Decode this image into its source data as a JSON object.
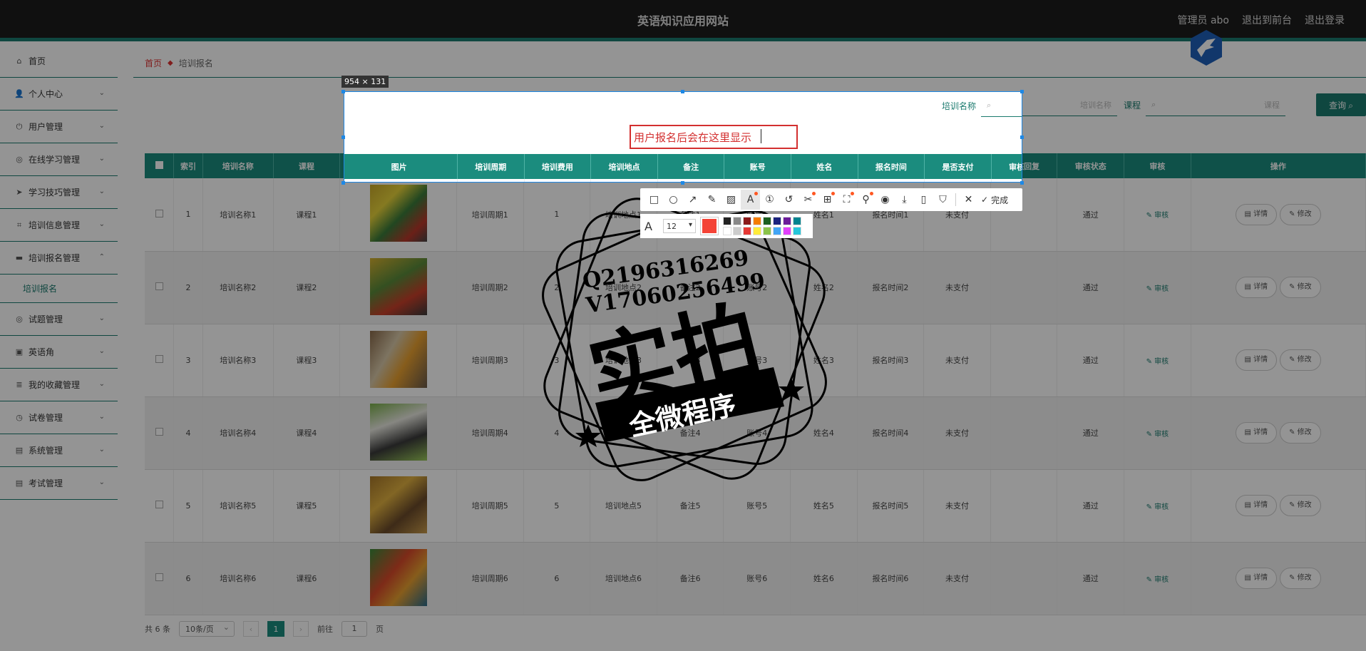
{
  "header": {
    "site_title": "英语知识应用网站",
    "admin": "管理员 abo",
    "to_front": "退出到前台",
    "logout": "退出登录"
  },
  "sidebar": {
    "items": [
      {
        "label": "首页",
        "icon": "home-icon",
        "glyph": "⌂"
      },
      {
        "label": "个人中心",
        "icon": "user-icon",
        "glyph": "👤"
      },
      {
        "label": "用户管理",
        "icon": "power-icon",
        "glyph": "⏻"
      },
      {
        "label": "在线学习管理",
        "icon": "globe-icon",
        "glyph": "◎"
      },
      {
        "label": "学习技巧管理",
        "icon": "send-icon",
        "glyph": "➤"
      },
      {
        "label": "培训信息管理",
        "icon": "crop-icon",
        "glyph": "⌗"
      },
      {
        "label": "培训报名管理",
        "icon": "chat-icon",
        "glyph": "▬"
      },
      {
        "label": "试题管理",
        "icon": "globe-icon",
        "glyph": "◎"
      },
      {
        "label": "英语角",
        "icon": "briefcase-icon",
        "glyph": "▣"
      },
      {
        "label": "我的收藏管理",
        "icon": "database-icon",
        "glyph": "≣"
      },
      {
        "label": "试卷管理",
        "icon": "clock-icon",
        "glyph": "◷"
      },
      {
        "label": "系统管理",
        "icon": "trash-icon",
        "glyph": "▤"
      },
      {
        "label": "考试管理",
        "icon": "trash-icon",
        "glyph": "▤"
      }
    ],
    "sub_item": "培训报名"
  },
  "breadcrumb": {
    "home": "首页",
    "current": "培训报名"
  },
  "search": {
    "label1": "培训名称",
    "placeholder1": "培训名称",
    "label2": "课程",
    "placeholder2": "课程",
    "button": "查询"
  },
  "table": {
    "columns": [
      "索引",
      "培训名称",
      "课程",
      "图片",
      "培训周期",
      "培训费用",
      "培训地点",
      "备注",
      "账号",
      "姓名",
      "报名时间",
      "是否支付",
      "审核回复",
      "审核状态",
      "审核",
      "操作"
    ],
    "rows": [
      {
        "idx": "1",
        "name": "培训名称1",
        "course": "课程1",
        "period": "培训周期1",
        "fee": "1",
        "place": "培训地点1",
        "note": "备注1",
        "account": "账号1",
        "uname": "姓名1",
        "time": "报名时间1",
        "paid": "未支付",
        "reply": "",
        "status": "通过"
      },
      {
        "idx": "2",
        "name": "培训名称2",
        "course": "课程2",
        "period": "培训周期2",
        "fee": "2",
        "place": "培训地点2",
        "note": "备注2",
        "account": "账号2",
        "uname": "姓名2",
        "time": "报名时间2",
        "paid": "未支付",
        "reply": "",
        "status": "通过"
      },
      {
        "idx": "3",
        "name": "培训名称3",
        "course": "课程3",
        "period": "培训周期3",
        "fee": "3",
        "place": "培训地点3",
        "note": "备注3",
        "account": "账号3",
        "uname": "姓名3",
        "time": "报名时间3",
        "paid": "未支付",
        "reply": "",
        "status": "通过"
      },
      {
        "idx": "4",
        "name": "培训名称4",
        "course": "课程4",
        "period": "培训周期4",
        "fee": "4",
        "place": "培训地点4",
        "note": "备注4",
        "account": "账号4",
        "uname": "姓名4",
        "time": "报名时间4",
        "paid": "未支付",
        "reply": "",
        "status": "通过"
      },
      {
        "idx": "5",
        "name": "培训名称5",
        "course": "课程5",
        "period": "培训周期5",
        "fee": "5",
        "place": "培训地点5",
        "note": "备注5",
        "account": "账号5",
        "uname": "姓名5",
        "time": "报名时间5",
        "paid": "未支付",
        "reply": "",
        "status": "通过"
      },
      {
        "idx": "6",
        "name": "培训名称6",
        "course": "课程6",
        "period": "培训周期6",
        "fee": "6",
        "place": "培训地点6",
        "note": "备注6",
        "account": "账号6",
        "uname": "姓名6",
        "time": "报名时间6",
        "paid": "未支付",
        "reply": "",
        "status": "通过"
      }
    ],
    "audit_label": "审核",
    "detail_label": "详情",
    "edit_label": "修改"
  },
  "pager": {
    "total": "共 6 条",
    "page_size": "10条/页",
    "current": "1",
    "goto_label": "前往",
    "goto_value": "1",
    "page_suffix": "页"
  },
  "capture": {
    "size_label": "954 × 131",
    "annotation": "用户报名后会在这里显示",
    "font_size": "12",
    "done": "完成",
    "current_color": "#f44336",
    "palette": [
      "#222222",
      "#888888",
      "#8b1a1a",
      "#f57c00",
      "#1b5e20",
      "#1a237e",
      "#6a1b9a",
      "#00838f",
      "#ffffff",
      "#cccccc",
      "#e53935",
      "#ffeb3b",
      "#8bc34a",
      "#42a5f5",
      "#e040fb",
      "#26c6da"
    ]
  },
  "watermark": {
    "line1": "Q2196316269",
    "line2": "V17060256499",
    "big": "实拍",
    "banner": "全微程序"
  },
  "colors": {
    "accent": "#1b7a6e",
    "header_bg": "#1c1c1c",
    "annotation": "#d32f2f"
  }
}
